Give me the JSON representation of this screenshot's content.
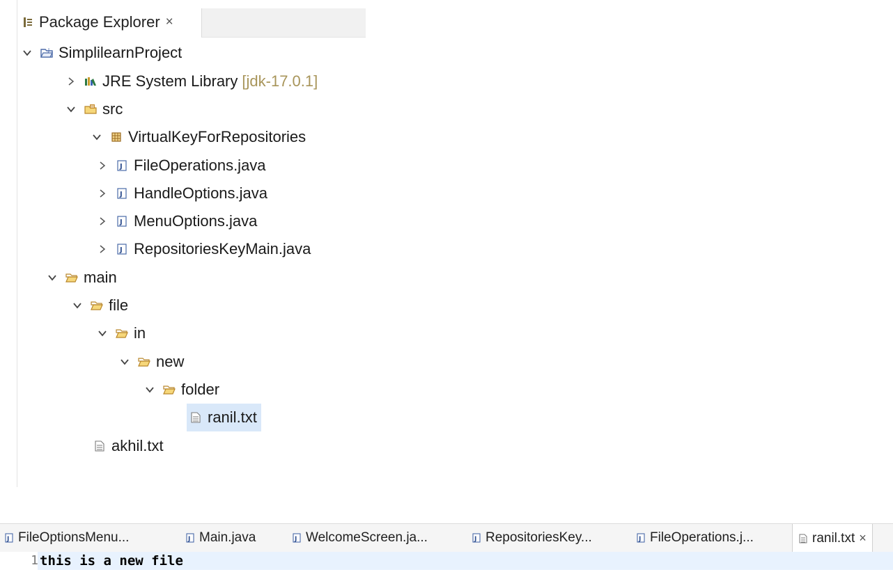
{
  "explorer": {
    "title": "Package Explorer",
    "close": "×",
    "tree": [
      {
        "label": "SimplilearnProject",
        "icon": "project-folder-icon",
        "toggle": "expanded"
      },
      {
        "label": "JRE System Library",
        "extra": "[jdk-17.0.1]",
        "icon": "library-icon",
        "toggle": "collapsed"
      },
      {
        "label": "src",
        "icon": "source-folder-icon",
        "toggle": "expanded"
      },
      {
        "label": "VirtualKeyForRepositories",
        "icon": "package-icon",
        "toggle": "expanded"
      },
      {
        "label": "FileOperations.java",
        "icon": "java-file-icon",
        "toggle": "collapsed"
      },
      {
        "label": "HandleOptions.java",
        "icon": "java-file-icon",
        "toggle": "collapsed"
      },
      {
        "label": "MenuOptions.java",
        "icon": "java-file-icon",
        "toggle": "collapsed"
      },
      {
        "label": "RepositoriesKeyMain.java",
        "icon": "java-file-icon",
        "toggle": "collapsed"
      },
      {
        "label": "main",
        "icon": "folder-icon",
        "toggle": "expanded"
      },
      {
        "label": "file",
        "icon": "folder-icon",
        "toggle": "expanded"
      },
      {
        "label": "in",
        "icon": "folder-icon",
        "toggle": "expanded"
      },
      {
        "label": "new",
        "icon": "folder-icon",
        "toggle": "expanded"
      },
      {
        "label": "folder",
        "icon": "folder-icon",
        "toggle": "expanded"
      },
      {
        "label": "ranil.txt",
        "icon": "text-file-icon",
        "toggle": "none",
        "selected": true
      },
      {
        "label": "akhil.txt",
        "icon": "text-file-icon",
        "toggle": "none"
      }
    ]
  },
  "editor": {
    "tabs": [
      {
        "label": "FileOptionsMenu...",
        "icon": "java-file-icon"
      },
      {
        "label": "Main.java",
        "icon": "java-file-icon"
      },
      {
        "label": "WelcomeScreen.ja...",
        "icon": "java-file-icon"
      },
      {
        "label": "RepositoriesKey...",
        "icon": "java-file-icon"
      },
      {
        "label": "FileOperations.j...",
        "icon": "java-file-icon"
      },
      {
        "label": "ranil.txt",
        "icon": "text-file-icon",
        "active": true,
        "close": "×"
      }
    ],
    "line_number": "1",
    "content": "this is a new file"
  },
  "colors": {
    "selection": "#d9e8f9",
    "current_line": "#e8f2fe",
    "library_version": "#a8955a"
  }
}
